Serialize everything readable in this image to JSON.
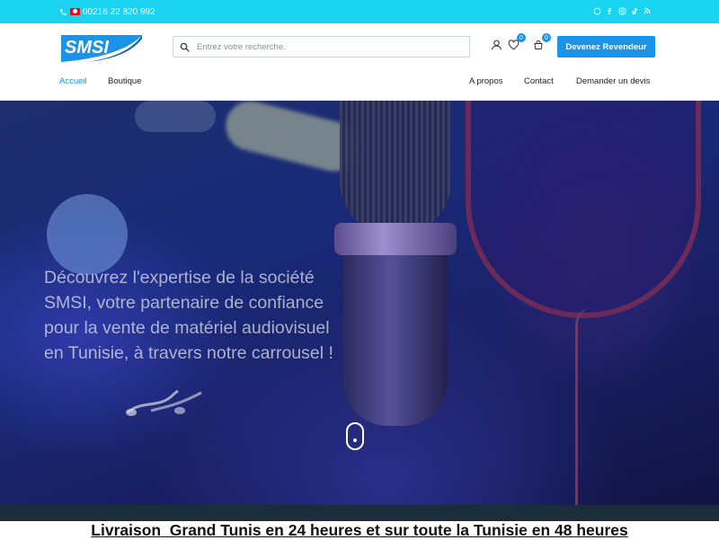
{
  "topbar": {
    "phone": "00216 22 820 992",
    "social_icons": [
      "whatsapp-icon",
      "facebook-icon",
      "instagram-icon",
      "tiktok-icon",
      "rss-icon"
    ]
  },
  "header": {
    "logo_text": "SMSI",
    "search_placeholder": "Entrez votre recherche.",
    "wishlist_count": "0",
    "cart_count": "0",
    "cta_label": "Devenez Revendeur"
  },
  "nav": {
    "left": [
      {
        "label": "Accueil",
        "active": true
      },
      {
        "label": "Boutique",
        "active": false
      }
    ],
    "right": [
      {
        "label": "A propos"
      },
      {
        "label": "Contact"
      },
      {
        "label": "Demander un devis"
      }
    ]
  },
  "hero": {
    "text": "Découvrez l'expertise de la société SMSI, votre partenaire de confiance pour la vente de matériel audiovisuel en Tunisie, à travers notre carrousel !"
  },
  "banner": {
    "text": "Livraison  Grand Tunis en 24 heures et sur toute la Tunisie en 48 heures"
  },
  "colors": {
    "topbar": "#1ad3f0",
    "accent": "#1a93e8",
    "hero_dark": "#1a1f63"
  }
}
